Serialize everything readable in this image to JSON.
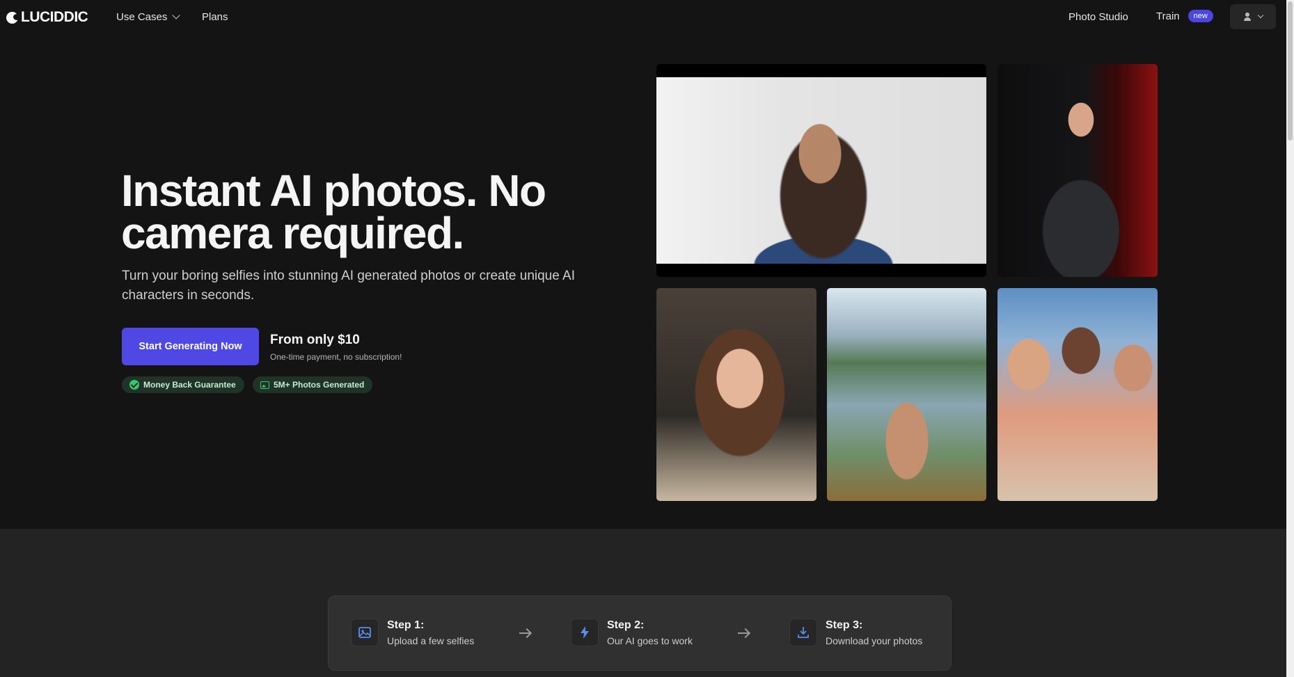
{
  "brand": {
    "name": "LUCIDDIC"
  },
  "nav": {
    "use_cases": "Use Cases",
    "plans": "Plans",
    "photo_studio": "Photo Studio",
    "train": "Train",
    "train_badge": "new"
  },
  "hero": {
    "title": "Instant AI photos. No camera required.",
    "subtitle": "Turn your boring selfies into stunning AI generated photos or create unique AI characters in seconds.",
    "cta": "Start Generating Now",
    "price_main": "From only $10",
    "price_note": "One-time payment, no subscription!",
    "badge_guarantee": "Money Back Guarantee",
    "badge_photos": "5M+ Photos Generated"
  },
  "steps": [
    {
      "title": "Step 1:",
      "desc": "Upload a few selfies",
      "icon": "image-icon"
    },
    {
      "title": "Step 2:",
      "desc": "Our AI goes to work",
      "icon": "lightning-icon"
    },
    {
      "title": "Step 3:",
      "desc": "Download your photos",
      "icon": "download-icon"
    }
  ],
  "colors": {
    "background": "#141414",
    "accent": "#5048e5",
    "badge_green": "#3ec46d",
    "step_icon_blue": "#5b8def"
  }
}
